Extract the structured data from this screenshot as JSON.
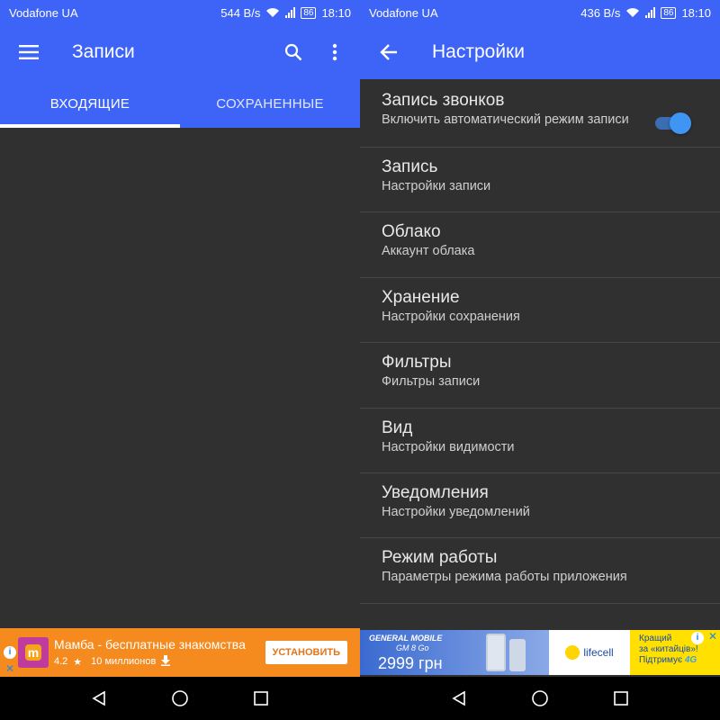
{
  "left": {
    "status": {
      "carrier": "Vodafone UA",
      "speed": "544 B/s",
      "battery": "86",
      "time": "18:10"
    },
    "appbar": {
      "title": "Записи"
    },
    "tabs": [
      {
        "label": "ВХОДЯЩИЕ",
        "active": true
      },
      {
        "label": "СОХРАНЕННЫЕ",
        "active": false
      }
    ],
    "ad": {
      "title": "Мамба - бесплатные знакомства",
      "logo_letter": "m",
      "rating": "4.2",
      "installs": "10 миллионов",
      "install_label": "УСТАНОВИТЬ"
    }
  },
  "right": {
    "status": {
      "carrier": "Vodafone UA",
      "speed": "436 B/s",
      "battery": "86",
      "time": "18:10"
    },
    "appbar": {
      "title": "Настройки"
    },
    "settings": [
      {
        "title": "Запись звонков",
        "subtitle": "Включить автоматический режим записи",
        "toggle": true
      },
      {
        "title": "Запись",
        "subtitle": "Настройки записи"
      },
      {
        "title": "Облако",
        "subtitle": "Аккаунт облака"
      },
      {
        "title": "Хранение",
        "subtitle": "Настройки сохранения"
      },
      {
        "title": "Фильтры",
        "subtitle": "Фильтры записи"
      },
      {
        "title": "Вид",
        "subtitle": "Настройки видимости"
      },
      {
        "title": "Уведомления",
        "subtitle": "Настройки уведомлений"
      },
      {
        "title": "Режим работы",
        "subtitle": "Параметры режима работы приложения"
      }
    ],
    "ad": {
      "brand": "GENERAL MOBILE",
      "model": "GM 8 Go",
      "price": "2999 грн",
      "operator": "lifecell",
      "slogan_line1": "Кращий",
      "slogan_line2": "за «китайців»!",
      "slogan_line3": "Підтримує",
      "slogan_4g": "4G"
    }
  },
  "colors": {
    "primary": "#3d63f7",
    "background": "#303030",
    "accent": "#3f95f4",
    "ad_orange": "#f58a1f"
  }
}
